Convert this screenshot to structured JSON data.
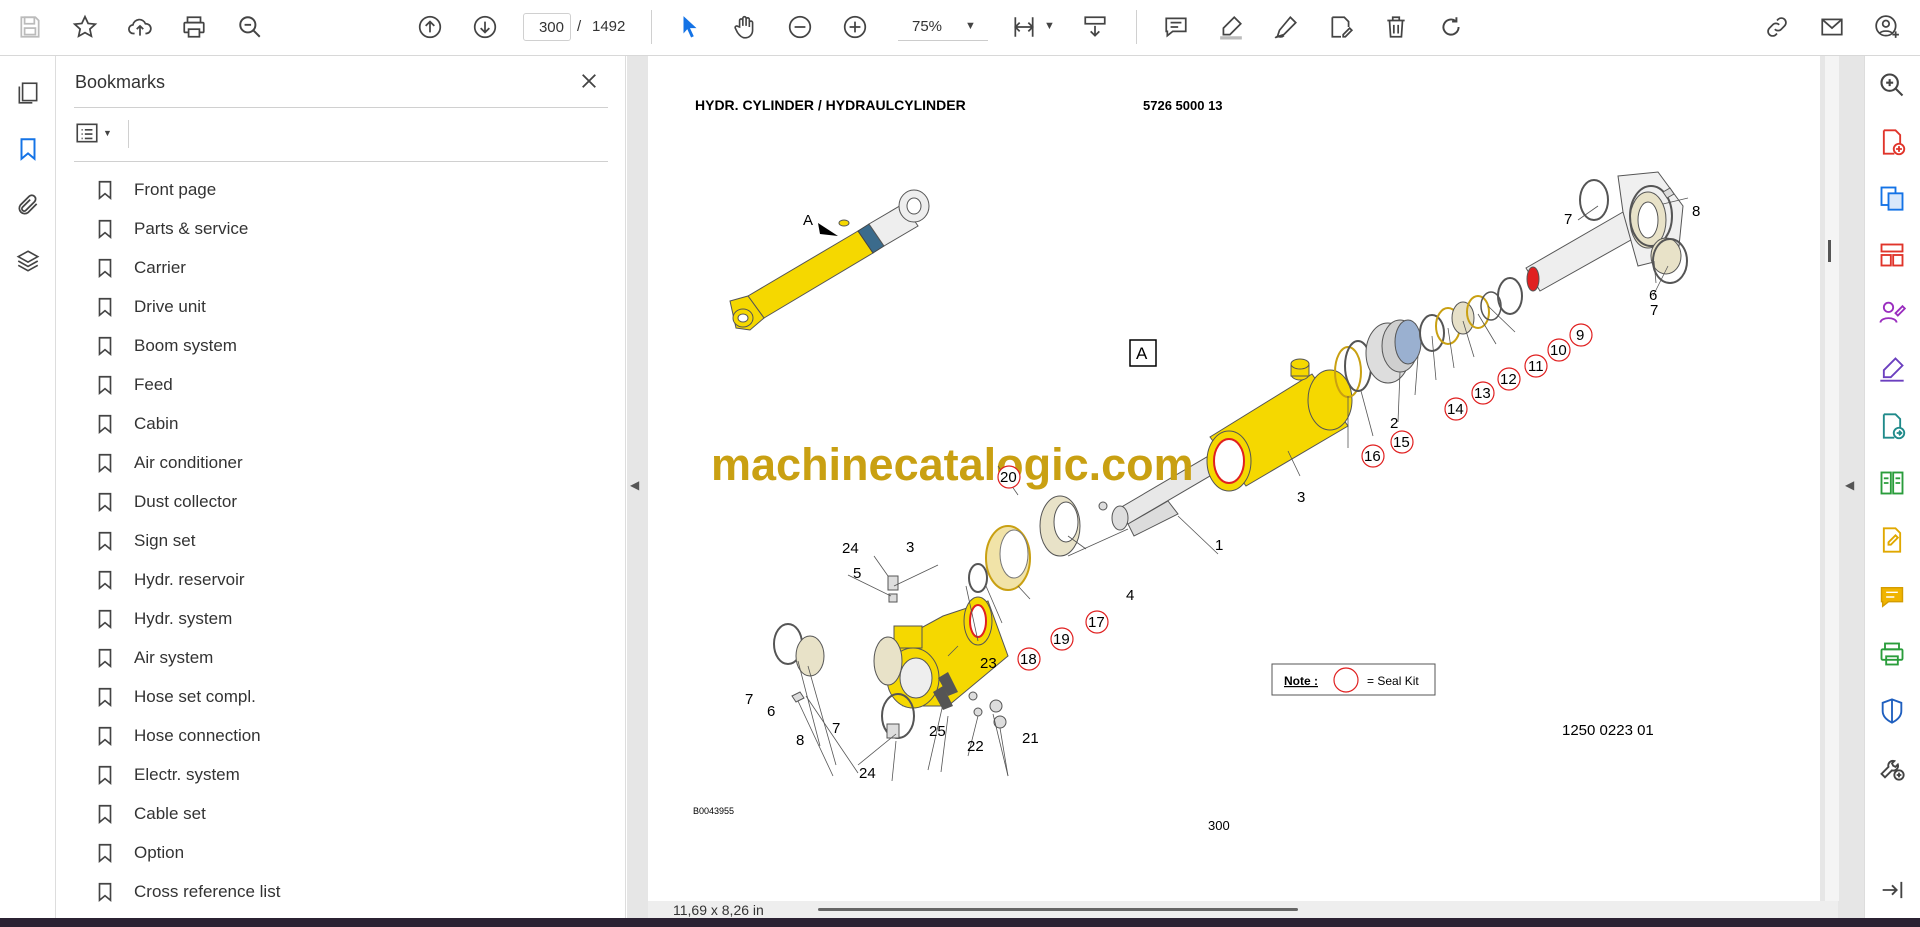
{
  "toolbar": {
    "current_page": "300",
    "page_separator": "/",
    "total_pages": "1492",
    "zoom": "75%"
  },
  "bookmarks": {
    "title": "Bookmarks",
    "items": [
      {
        "label": "Front page"
      },
      {
        "label": "Parts & service"
      },
      {
        "label": "Carrier"
      },
      {
        "label": "Drive unit"
      },
      {
        "label": "Boom system"
      },
      {
        "label": "Feed"
      },
      {
        "label": "Cabin"
      },
      {
        "label": "Air conditioner"
      },
      {
        "label": "Dust collector"
      },
      {
        "label": "Sign set"
      },
      {
        "label": "Hydr. reservoir"
      },
      {
        "label": "Hydr. system"
      },
      {
        "label": "Air system"
      },
      {
        "label": "Hose set compl."
      },
      {
        "label": "Hose connection"
      },
      {
        "label": "Electr. system"
      },
      {
        "label": "Cable set"
      },
      {
        "label": "Option"
      },
      {
        "label": "Cross reference list"
      }
    ]
  },
  "document": {
    "title": "HYDR. CYLINDER / HYDRAULCYLINDER",
    "part_number": "5726 5000 13",
    "view_label": "A",
    "detail_label": "A",
    "watermark": "machinecatalogic.com",
    "note_label": "Note :",
    "note_text": "= Seal Kit",
    "drawing_number": "1250 0223 01",
    "image_id": "B0043955",
    "page_number": "300",
    "page_size": "11,69 x 8,26 in",
    "callouts": {
      "c1": "1",
      "c2": "2",
      "c3a": "3",
      "c3b": "3",
      "c4": "4",
      "c5": "5",
      "c6a": "6",
      "c6b": "6",
      "c7a": "7",
      "c7b": "7",
      "c7c": "7",
      "c7d": "7",
      "c8a": "8",
      "c8b": "8",
      "c9": "9",
      "c10": "10",
      "c11": "11",
      "c12": "12",
      "c13": "13",
      "c14": "14",
      "c15": "15",
      "c16": "16",
      "c17": "17",
      "c18": "18",
      "c19": "19",
      "c20": "20",
      "c21": "21",
      "c22": "22",
      "c23": "23",
      "c24a": "24",
      "c24b": "24",
      "c25": "25"
    }
  },
  "colors": {
    "cylinder": "#f5d800",
    "seal_circle": "#e02020",
    "watermark": "#c9a012",
    "active_icon": "#1473e6"
  }
}
